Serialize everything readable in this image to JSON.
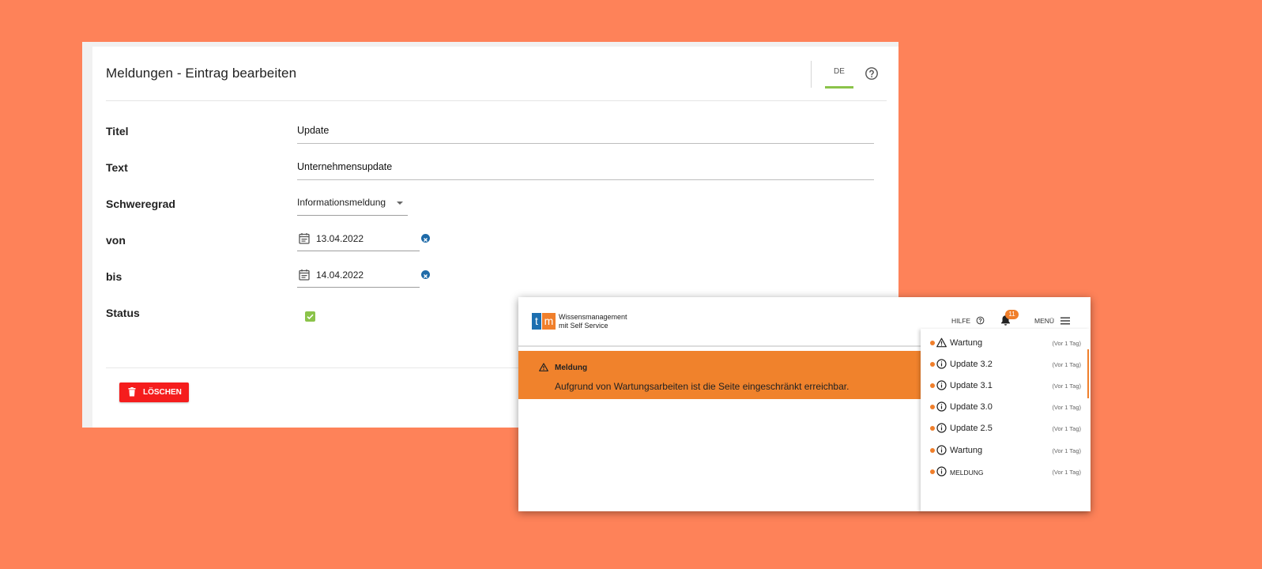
{
  "edit": {
    "title": "Meldungen - Eintrag bearbeiten",
    "lang": "DE",
    "fields": {
      "titel_label": "Titel",
      "titel_value": "Update",
      "text_label": "Text",
      "text_value": "Unternehmensupdate",
      "schweregrad_label": "Schweregrad",
      "schweregrad_value": "Informationsmeldung",
      "von_label": "von",
      "von_value": "13.04.2022",
      "bis_label": "bis",
      "bis_value": "14.04.2022",
      "status_label": "Status",
      "status_checked": true
    },
    "delete_label": "LÖSCHEN"
  },
  "preview": {
    "logo_letters": [
      "t",
      "m"
    ],
    "logo_line1": "Wissensmanagement",
    "logo_line2": "mit Self Service",
    "help_label": "HILFE",
    "badge_count": "11",
    "menu_label": "MENÜ",
    "banner_title": "Meldung",
    "banner_text": "Aufgrund von Wartungsarbeiten ist die Seite eingeschränkt erreichbar.",
    "notifications": [
      {
        "icon": "warning-icon",
        "label": "Wartung",
        "time": "(Vor 1 Tag)"
      },
      {
        "icon": "info-icon",
        "label": "Update 3.2",
        "time": "(Vor 1 Tag)"
      },
      {
        "icon": "info-icon",
        "label": "Update 3.1",
        "time": "(Vor 1 Tag)"
      },
      {
        "icon": "info-icon",
        "label": "Update 3.0",
        "time": "(Vor 1 Tag)"
      },
      {
        "icon": "info-icon",
        "label": "Update 2.5",
        "time": "(Vor 1 Tag)"
      },
      {
        "icon": "info-icon",
        "label": "Wartung",
        "time": "(Vor 1 Tag)"
      },
      {
        "icon": "info-icon",
        "label": "MELDUNG",
        "time": "(Vor 1 Tag)"
      }
    ]
  },
  "colors": {
    "background": "#fe8259",
    "accent_green": "#8bc34a",
    "brand_orange": "#f07f2b",
    "brand_blue": "#1d6fb0",
    "danger": "#f51d1d"
  }
}
